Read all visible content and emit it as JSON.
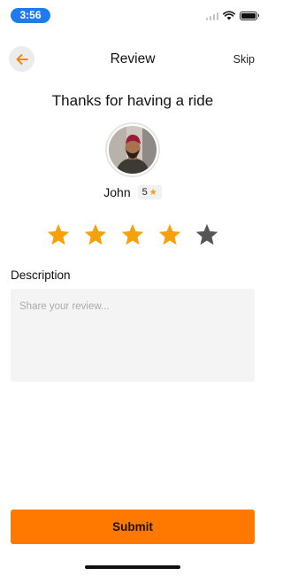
{
  "status_bar": {
    "time": "3:56"
  },
  "nav": {
    "title": "Review",
    "skip_label": "Skip",
    "back_icon": "arrow-left-icon"
  },
  "headline": "Thanks for having a ride",
  "driver": {
    "name": "John",
    "rating": "5"
  },
  "review_rating": {
    "selected": 4,
    "max": 5
  },
  "description": {
    "label": "Description",
    "placeholder": "Share your review...",
    "value": ""
  },
  "submit_label": "Submit",
  "colors": {
    "accent": "#ff7800",
    "star_active": "#f5a10c",
    "star_inactive": "#555555",
    "time_pill": "#1f7cf0"
  }
}
